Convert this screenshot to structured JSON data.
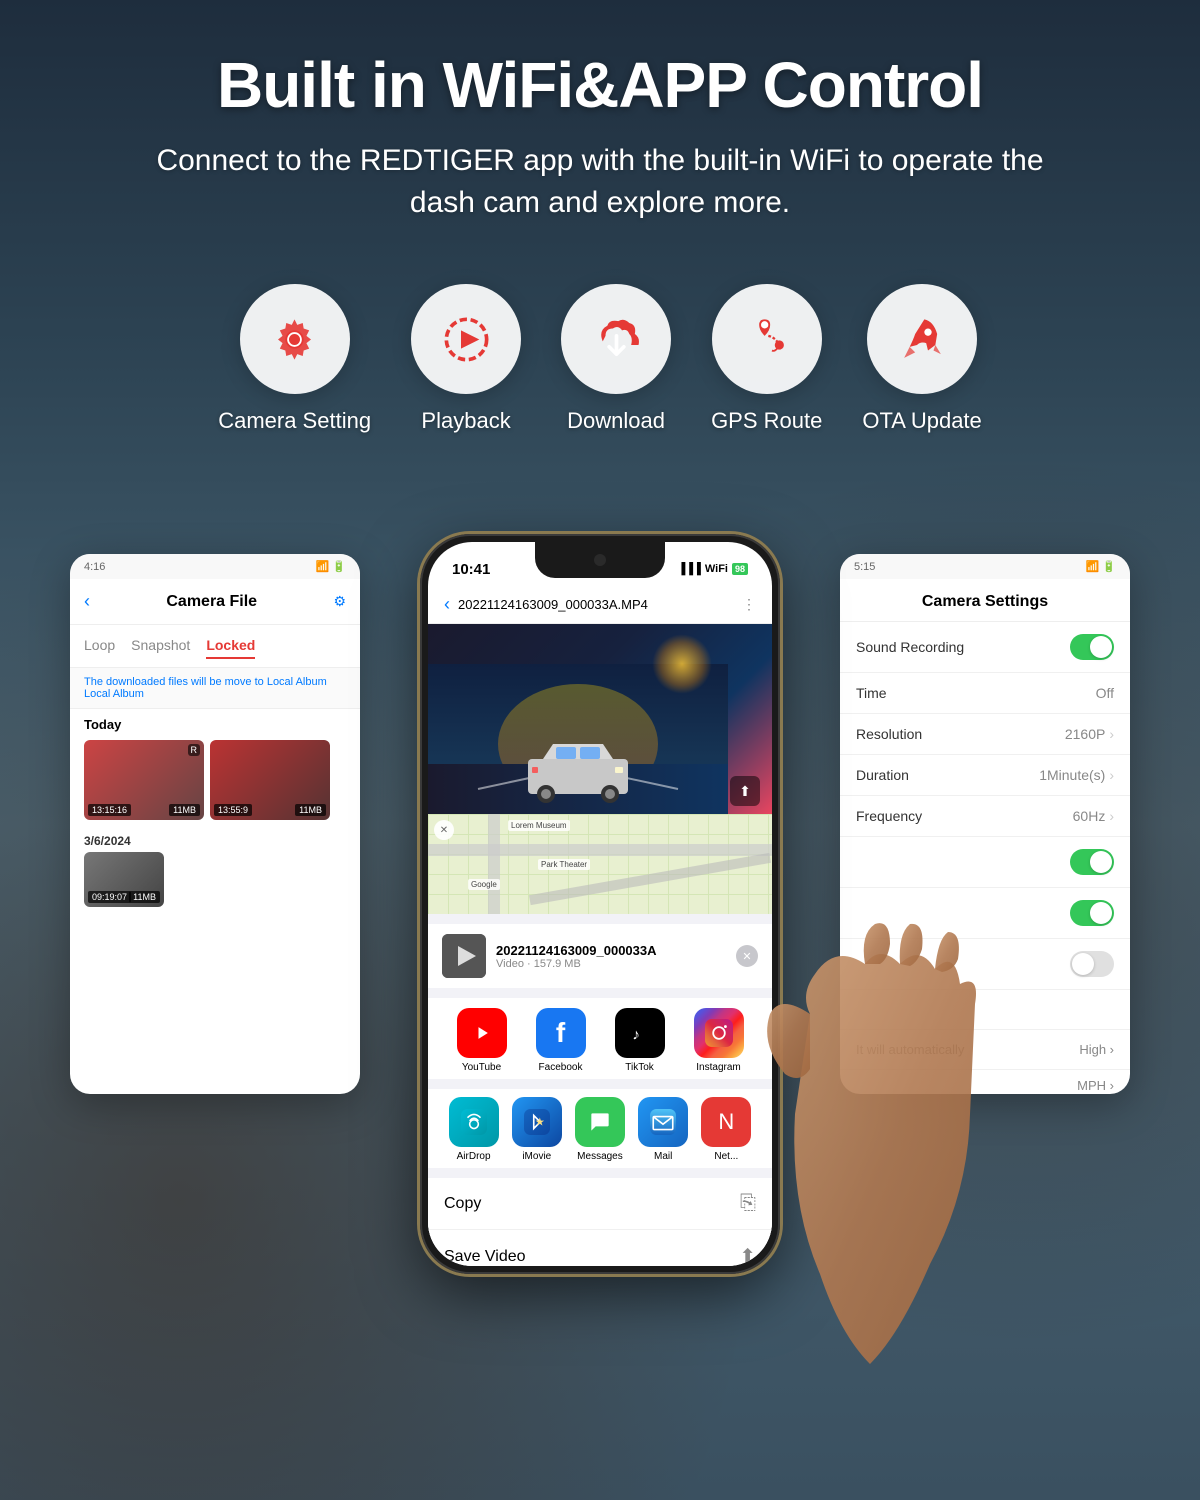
{
  "header": {
    "title": "Built in WiFi&APP Control",
    "subtitle": "Connect to the REDTIGER app with the built-in WiFi\nto operate the dash cam and explore more."
  },
  "features": [
    {
      "id": "camera-setting",
      "label": "Camera Setting",
      "icon": "⚙️",
      "color": "#e53935"
    },
    {
      "id": "playback",
      "label": "Playback",
      "icon": "▶️",
      "color": "#e53935"
    },
    {
      "id": "download",
      "label": "Download",
      "icon": "☁️",
      "color": "#e53935"
    },
    {
      "id": "gps-route",
      "label": "GPS Route",
      "icon": "📍",
      "color": "#e53935"
    },
    {
      "id": "ota-update",
      "label": "OTA Update",
      "icon": "🚀",
      "color": "#e53935"
    }
  ],
  "left_panel": {
    "status_time": "4:16",
    "title": "Camera File",
    "tabs": [
      "Loop",
      "Snapshot",
      "Locked"
    ],
    "active_tab": "Locked",
    "notice": "The downloaded files will be move to Local Album",
    "section_today": "Today",
    "thumb1_duration": "13:15:16",
    "thumb1_size": "11MB",
    "thumb2_duration": "13:55:9",
    "thumb2_size": "11MB",
    "section_date": "3/6/2024",
    "thumb3_duration": "09:19:07",
    "thumb3_size": "11MB"
  },
  "right_panel": {
    "status_time": "5:15",
    "title": "Camera Settings",
    "rows": [
      {
        "label": "Sound Recording",
        "value": "",
        "type": "toggle",
        "on": true
      },
      {
        "label": "Time",
        "value": "Off",
        "type": "text"
      },
      {
        "label": "Resolution",
        "value": "2160P",
        "type": "chevron"
      },
      {
        "label": "Duration",
        "value": "1Minute(s)",
        "type": "chevron"
      },
      {
        "label": "Frequency",
        "value": "60Hz",
        "type": "chevron"
      }
    ]
  },
  "phone": {
    "status_time": "10:41",
    "filename": "20221124163009_000033A.MP4",
    "share_filename": "20221124163009_000033A",
    "share_filetype": "Video · 157.9 MB",
    "apps_row1": [
      {
        "id": "youtube",
        "label": "YouTube",
        "icon": "▶"
      },
      {
        "id": "facebook",
        "label": "Facebook",
        "icon": "f"
      },
      {
        "id": "tiktok",
        "label": "TikTok",
        "icon": "♪"
      },
      {
        "id": "instagram",
        "label": "Instagram",
        "icon": "📷"
      }
    ],
    "apps_row2": [
      {
        "id": "airdrop",
        "label": "AirDrop",
        "icon": "📡"
      },
      {
        "id": "imovie",
        "label": "iMovie",
        "icon": "⭐"
      },
      {
        "id": "messages",
        "label": "Messages",
        "icon": "💬"
      },
      {
        "id": "mail",
        "label": "Mail",
        "icon": "✉"
      },
      {
        "id": "net",
        "label": "Net...",
        "icon": "🌐"
      }
    ],
    "actions": [
      {
        "id": "copy",
        "label": "Copy",
        "icon": "⎘"
      },
      {
        "id": "save-video",
        "label": "Save Video",
        "icon": "⬆"
      }
    ]
  }
}
